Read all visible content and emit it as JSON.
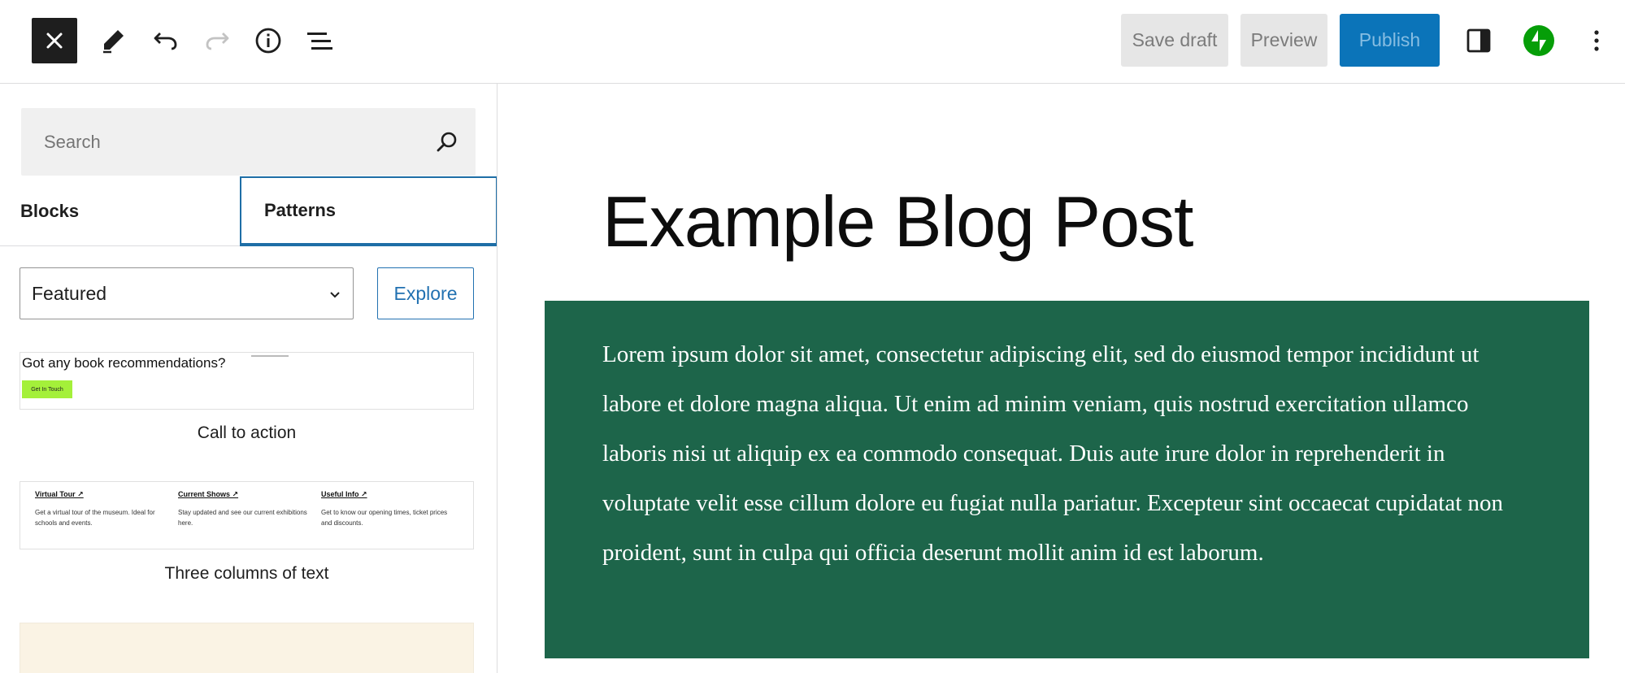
{
  "toolbar": {
    "close_icon": "close-icon",
    "tool_icon": "pencil-icon",
    "undo_icon": "undo-icon",
    "redo_icon": "redo-icon",
    "details_icon": "info-icon",
    "list_view_icon": "list-view-icon",
    "save_draft_label": "Save draft",
    "preview_label": "Preview",
    "publish_label": "Publish",
    "settings_icon": "sidebar-toggle-icon",
    "jetpack_icon": "jetpack-icon",
    "options_icon": "more-vertical-icon",
    "colors": {
      "publish_bg": "#0b74b9",
      "jetpack_green": "#069e08",
      "dark": "#1e1e1e"
    }
  },
  "inserter": {
    "search": {
      "placeholder": "Search",
      "value": ""
    },
    "tabs": [
      {
        "label": "Blocks",
        "active": false
      },
      {
        "label": "Patterns",
        "active": true
      }
    ],
    "category_select": {
      "selected": "Featured"
    },
    "explore_label": "Explore",
    "patterns": [
      {
        "label": "Call to action",
        "preview": {
          "heading": "Got any book recommendations?",
          "button": "Get In Touch"
        }
      },
      {
        "label": "Three columns of text",
        "preview": {
          "columns": [
            {
              "heading": "Virtual Tour ↗",
              "body": "Get a virtual tour of the museum. Ideal for schools and events."
            },
            {
              "heading": "Current Shows ↗",
              "body": "Stay updated and see our current exhibitions here."
            },
            {
              "heading": "Useful Info ↗",
              "body": "Get to know our opening times, ticket prices and discounts."
            }
          ]
        }
      }
    ]
  },
  "editor": {
    "post_title": "Example Blog Post",
    "group_background": "#1d654a",
    "paragraph": "Lorem ipsum dolor sit amet, consectetur adipiscing elit, sed do eiusmod tempor incididunt ut labore et dolore magna aliqua. Ut enim ad minim veniam, quis nostrud exercitation ullamco laboris nisi ut aliquip ex ea commodo consequat. Duis aute irure dolor in reprehenderit in voluptate velit esse cillum dolore eu fugiat nulla pariatur. Excepteur sint occaecat cupidatat non proident, sunt in culpa qui officia deserunt mollit anim id est laborum."
  }
}
